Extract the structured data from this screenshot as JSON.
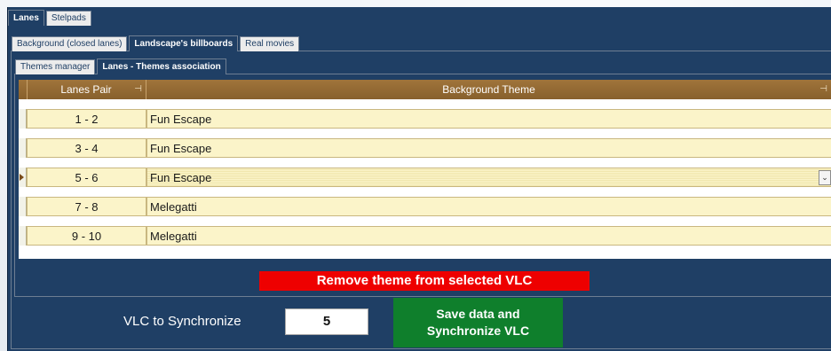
{
  "tabs_level1": [
    "Lanes",
    "Stelpads"
  ],
  "tabs_level2": [
    "Background (closed lanes)",
    "Landscape's billboards",
    "Real movies"
  ],
  "tabs_level3": [
    "Themes manager",
    "Lanes - Themes association"
  ],
  "grid": {
    "columns": [
      "Lanes Pair",
      "Background Theme"
    ],
    "rows": [
      {
        "pair": "1 - 2",
        "theme": "Fun Escape"
      },
      {
        "pair": "3 - 4",
        "theme": "Fun Escape"
      },
      {
        "pair": "5 - 6",
        "theme": "Fun Escape"
      },
      {
        "pair": "7 - 8",
        "theme": "Melegatti"
      },
      {
        "pair": "9 - 10",
        "theme": "Melegatti"
      }
    ]
  },
  "remove_button_label": "Remove theme from selected VLC",
  "sync": {
    "label": "VLC to Synchronize",
    "value": "5"
  },
  "save_button": {
    "line1": "Save data and",
    "line2": "Synchronize VLC"
  },
  "colors": {
    "app_background": "#1f3f65",
    "header": "#a0743b",
    "row": "#fbf4c9",
    "remove_button": "#ee0000",
    "save_button": "#0f7f2c"
  }
}
